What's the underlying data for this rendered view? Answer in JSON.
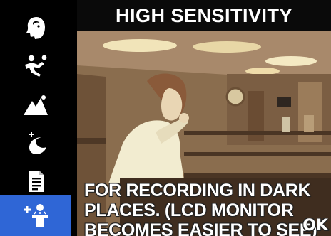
{
  "menu": {
    "modes": [
      {
        "name": "portrait",
        "icon": "portrait-icon",
        "selected": false
      },
      {
        "name": "sports",
        "icon": "sports-icon",
        "selected": false
      },
      {
        "name": "landscape",
        "icon": "landscape-icon",
        "selected": false
      },
      {
        "name": "night-scene",
        "icon": "night-scene-icon",
        "selected": false
      },
      {
        "name": "text",
        "icon": "text-document-icon",
        "selected": false
      },
      {
        "name": "high-sensitivity",
        "icon": "high-sensitivity-icon",
        "selected": true
      }
    ],
    "selected_color": "#2f66d6"
  },
  "panel": {
    "title": "HIGH SENSITIVITY",
    "description_lines": [
      "FOR RECORDING IN DARK",
      "PLACES. (LCD MONITOR",
      "BECOMES EASIER TO SEE)"
    ],
    "ok_label": "OK"
  }
}
